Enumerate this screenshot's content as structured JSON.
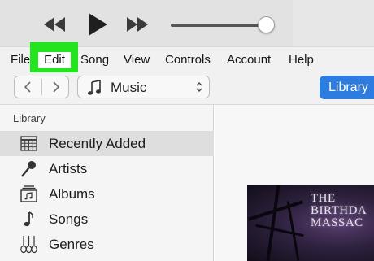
{
  "menubar": {
    "file": "File",
    "edit": "Edit",
    "song": "Song",
    "view": "View",
    "controls": "Controls",
    "account": "Account",
    "help": "Help",
    "highlight_color": "#22e51f"
  },
  "player": {
    "prev_icon": "rewind-icon",
    "play_icon": "play-icon",
    "next_icon": "fast-forward-icon",
    "volume_level": 0.9
  },
  "toolbar": {
    "back_icon": "chevron-left-icon",
    "forward_icon": "chevron-right-icon",
    "source_icon": "music-note-icon",
    "source_label": "Music",
    "library_button": "Library",
    "accent_color": "#2d7ce0"
  },
  "sidebar": {
    "header": "Library",
    "items": [
      {
        "label": "Recently Added",
        "icon": "calendar-grid-icon",
        "selected": true
      },
      {
        "label": "Artists",
        "icon": "microphone-icon",
        "selected": false
      },
      {
        "label": "Albums",
        "icon": "album-stack-icon",
        "selected": false
      },
      {
        "label": "Songs",
        "icon": "music-note-icon",
        "selected": false
      },
      {
        "label": "Genres",
        "icon": "guitars-icon",
        "selected": false
      }
    ]
  },
  "content": {
    "album_title_lines": [
      "THE",
      "BIRTHDA",
      "MASSAC"
    ]
  }
}
